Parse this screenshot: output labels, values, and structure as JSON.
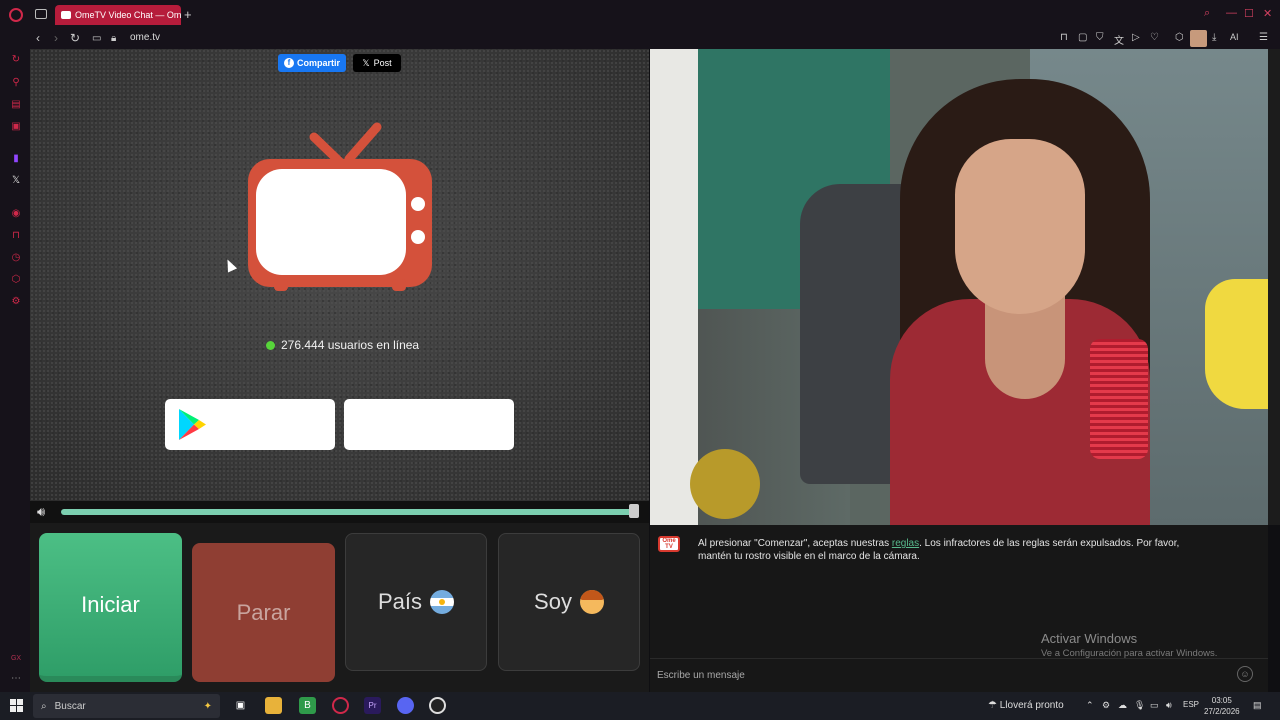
{
  "browser": {
    "tab_title": "OmeTV Video Chat — Ome",
    "url": "ome.tv",
    "ai_label": "AI"
  },
  "share": {
    "facebook_label": "Compartir",
    "x_label": "Post"
  },
  "stats": {
    "online_text": "276.444 usuarios en línea"
  },
  "controls": {
    "start_label": "Iniciar",
    "stop_label": "Parar",
    "country_label": "País",
    "gender_label": "Soy"
  },
  "volume": {
    "level": 1.0
  },
  "chat": {
    "message_before": "Al presionar \"Comenzar\", aceptas nuestras ",
    "rules_link": "reglas",
    "message_after": ". Los infractores de las reglas serán expulsados. Por favor, mantén tu rostro visible en el marco de la cámara.",
    "input_placeholder": "Escribe un mensaje",
    "logo_text": "Ome TV"
  },
  "watermark": {
    "title": "Activar Windows",
    "subtitle": "Ve a Configuración para activar Windows."
  },
  "taskbar": {
    "search_label": "Buscar",
    "weather": "Lloverá pronto",
    "language": "ESP",
    "time": "03:05",
    "date": "27/2/2026"
  },
  "colors": {
    "accent": "#d0284a",
    "start_button": "#3fb57a",
    "stop_button": "#8f3e33",
    "online_dot": "#57d43a",
    "ometv_red": "#d4513b"
  }
}
